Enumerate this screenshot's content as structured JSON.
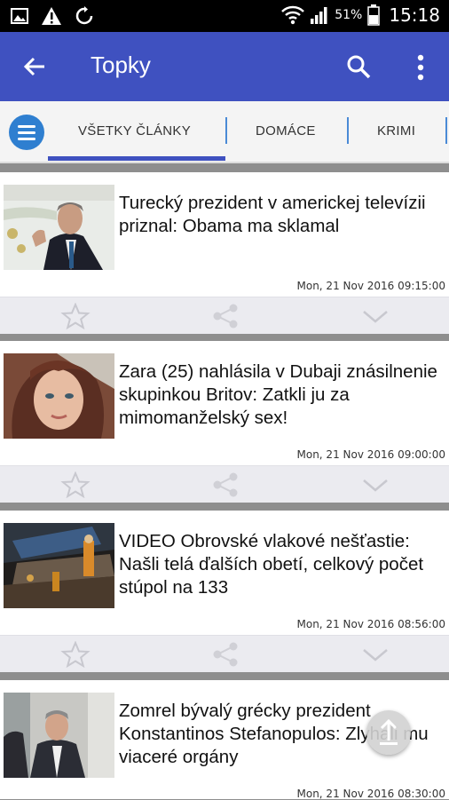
{
  "status_bar": {
    "battery_percent": "51%",
    "time": "15:18"
  },
  "app_bar": {
    "title": "Topky"
  },
  "tabs": [
    {
      "label": "VŠETKY ČLÁNKY",
      "active": true
    },
    {
      "label": "DOMÁCE",
      "active": false
    },
    {
      "label": "KRIMI",
      "active": false
    }
  ],
  "articles": [
    {
      "headline": "Turecký prezident v americkej televízii priznal: Obama ma sklamal",
      "date": "Mon, 21 Nov 2016 09:15:00"
    },
    {
      "headline": "Zara (25) nahlásila v Dubaji znásilnenie skupinkou Britov: Zatkli ju za mimomanželský sex!",
      "date": "Mon, 21 Nov 2016 09:00:00"
    },
    {
      "headline": "VIDEO Obrovské vlakové nešťastie: Našli telá ďalších obetí, celkový počet stúpol na 133",
      "date": "Mon, 21 Nov 2016 08:56:00"
    },
    {
      "headline": "Zomrel bývalý grécky prezident Konstantinos Stefanopulos: Zlyhali mu viaceré orgány",
      "date": "Mon, 21 Nov 2016 08:30:00"
    }
  ],
  "colors": {
    "app_bar": "#3f51c0",
    "tab_menu": "#2f7fd0",
    "background": "#8e8e8e"
  }
}
